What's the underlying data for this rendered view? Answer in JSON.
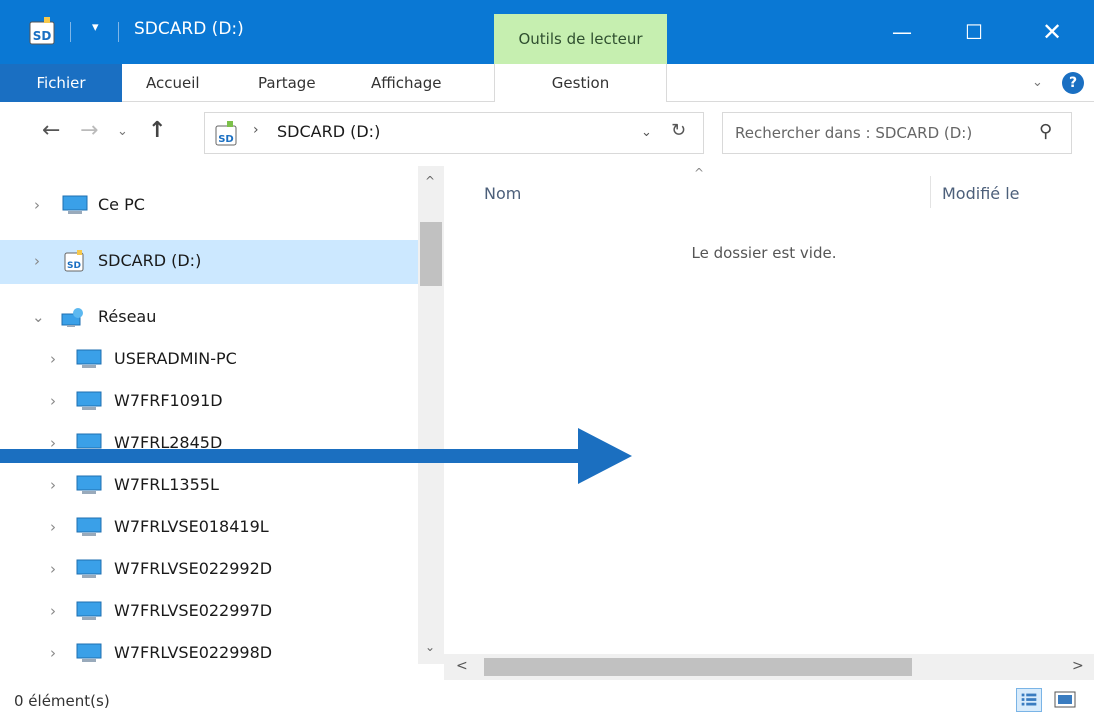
{
  "window": {
    "title": "SDCARD (D:)",
    "contextual_tab": "Outils de lecteur",
    "minimize_glyph": "—",
    "maximize_glyph": "☐",
    "close_glyph": "✕",
    "quick_access_glyph": "▾"
  },
  "ribbon": {
    "tabs": {
      "file": "Fichier",
      "home": "Accueil",
      "share": "Partage",
      "view": "Affichage",
      "manage": "Gestion"
    },
    "expand_glyph": "⌄",
    "help_glyph": "?"
  },
  "address": {
    "back_glyph": "←",
    "forward_glyph": "→",
    "recent_glyph": "⌄",
    "up_glyph": "↑",
    "breadcrumb_sep": "›",
    "breadcrumb": "SDCARD (D:)",
    "dropdown_glyph": "⌄",
    "refresh_glyph": "↻"
  },
  "search": {
    "placeholder": "Rechercher dans : SDCARD (D:)",
    "icon": "search-icon",
    "glyph": "⚲"
  },
  "nav": {
    "expand_glyph": "›",
    "collapse_glyph": "⌄",
    "items": [
      {
        "label": "Ce PC",
        "icon": "computer-icon"
      },
      {
        "label": "SDCARD (D:)",
        "icon": "sd-card-icon"
      },
      {
        "label": "Réseau",
        "icon": "network-icon"
      },
      {
        "label": "USERADMIN-PC",
        "icon": "computer-icon"
      },
      {
        "label": "W7FRF1091D",
        "icon": "computer-icon"
      },
      {
        "label": "W7FRL2845D",
        "icon": "computer-icon"
      },
      {
        "label": "W7FRL1355L",
        "icon": "computer-icon"
      },
      {
        "label": "W7FRLVSE018419L",
        "icon": "computer-icon"
      },
      {
        "label": "W7FRLVSE022992D",
        "icon": "computer-icon"
      },
      {
        "label": "W7FRLVSE022997D",
        "icon": "computer-icon"
      },
      {
        "label": "W7FRLVSE022998D",
        "icon": "computer-icon"
      }
    ]
  },
  "scroll": {
    "up_glyph": "^",
    "down_glyph": "⌄",
    "left_glyph": "<",
    "right_glyph": ">",
    "sort_caret": "^"
  },
  "content": {
    "columns": {
      "name": "Nom",
      "modified": "Modifié le"
    },
    "empty_message": "Le dossier est vide."
  },
  "status": {
    "item_count": "0 élément(s)"
  },
  "colors": {
    "titlebar": "#0a78d4",
    "file_tab": "#1a6fc2",
    "contextual_tab": "#c6efb0",
    "selection": "#cce8ff",
    "overlay_arrow": "#1b6fc0"
  }
}
